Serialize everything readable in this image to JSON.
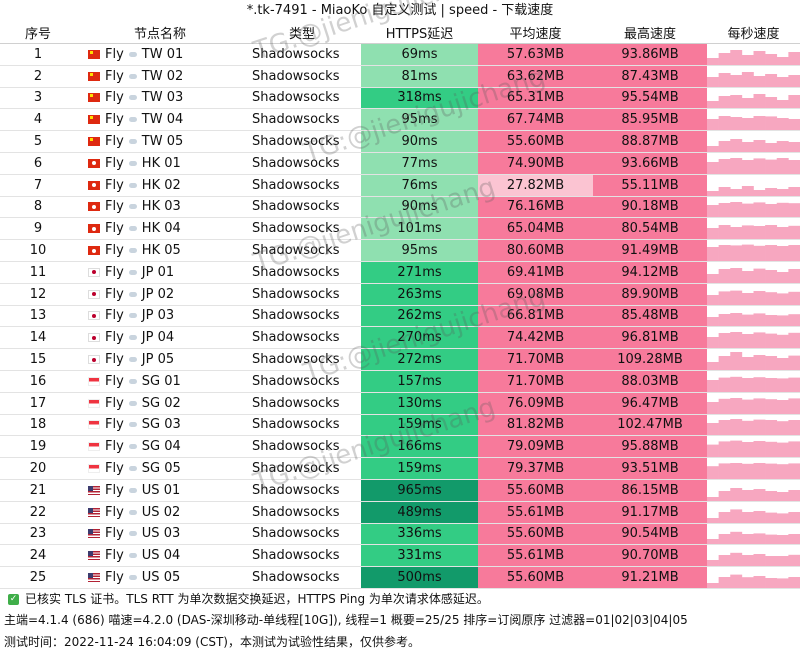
{
  "title": "*.tk-7491 - MiaoKo 自定义测试 | speed - 下载速度",
  "headers": {
    "no": "序号",
    "name": "节点名称",
    "type": "类型",
    "latency": "HTTPS延迟",
    "avg": "平均速度",
    "max": "最高速度",
    "per_second": "每秒速度"
  },
  "flag_icons": {
    "TW": "flag-cn-icon",
    "HK": "flag-hk-icon",
    "JP": "flag-jp-icon",
    "SG": "flag-sg-icon",
    "US": "flag-us-icon"
  },
  "colors": {
    "latency_light": "#8fe0b0",
    "latency_mid": "#33cc84",
    "latency_dark": "#129a6a",
    "speed_pink": "#f77a9b",
    "speed_pale": "#fbc4d2",
    "spark_pink": "#f7a7c0"
  },
  "rows": [
    {
      "no": "1",
      "prefix": "Fly",
      "node": "TW 01",
      "region": "TW",
      "type": "Shadowsocks",
      "latency": "69ms",
      "avg": "57.63MB",
      "max": "93.86MB",
      "spark": [
        0.35,
        0.6,
        0.75,
        0.5,
        0.7,
        0.55,
        0.4,
        0.65
      ]
    },
    {
      "no": "2",
      "prefix": "Fly",
      "node": "TW 02",
      "region": "TW",
      "type": "Shadowsocks",
      "latency": "81ms",
      "avg": "63.62MB",
      "max": "87.43MB",
      "spark": [
        0.5,
        0.7,
        0.6,
        0.75,
        0.55,
        0.65,
        0.5,
        0.6
      ]
    },
    {
      "no": "3",
      "prefix": "Fly",
      "node": "TW 03",
      "region": "TW",
      "type": "Shadowsocks",
      "latency": "318ms",
      "avg": "65.31MB",
      "max": "95.54MB",
      "spark": [
        0.4,
        0.65,
        0.7,
        0.55,
        0.75,
        0.6,
        0.45,
        0.7
      ]
    },
    {
      "no": "4",
      "prefix": "Fly",
      "node": "TW 04",
      "region": "TW",
      "type": "Shadowsocks",
      "latency": "95ms",
      "avg": "67.74MB",
      "max": "85.95MB",
      "spark": [
        0.55,
        0.7,
        0.65,
        0.6,
        0.7,
        0.68,
        0.6,
        0.55
      ]
    },
    {
      "no": "5",
      "prefix": "Fly",
      "node": "TW 05",
      "region": "TW",
      "type": "Shadowsocks",
      "latency": "90ms",
      "avg": "55.60MB",
      "max": "88.87MB",
      "spark": [
        0.3,
        0.55,
        0.65,
        0.5,
        0.6,
        0.45,
        0.55,
        0.5
      ]
    },
    {
      "no": "6",
      "prefix": "Fly",
      "node": "HK 01",
      "region": "HK",
      "type": "Shadowsocks",
      "latency": "77ms",
      "avg": "74.90MB",
      "max": "93.66MB",
      "spark": [
        0.6,
        0.75,
        0.8,
        0.7,
        0.78,
        0.72,
        0.8,
        0.7
      ]
    },
    {
      "no": "7",
      "prefix": "Fly",
      "node": "HK 02",
      "region": "HK",
      "type": "Shadowsocks",
      "latency": "76ms",
      "avg": "27.82MB",
      "max": "55.11MB",
      "spark": [
        0.25,
        0.45,
        0.35,
        0.5,
        0.3,
        0.4,
        0.35,
        0.45
      ]
    },
    {
      "no": "8",
      "prefix": "Fly",
      "node": "HK 03",
      "region": "HK",
      "type": "Shadowsocks",
      "latency": "90ms",
      "avg": "76.16MB",
      "max": "90.18MB",
      "spark": [
        0.65,
        0.75,
        0.8,
        0.72,
        0.78,
        0.7,
        0.76,
        0.74
      ]
    },
    {
      "no": "9",
      "prefix": "Fly",
      "node": "HK 04",
      "region": "HK",
      "type": "Shadowsocks",
      "latency": "101ms",
      "avg": "65.04MB",
      "max": "80.54MB",
      "spark": [
        0.55,
        0.7,
        0.6,
        0.68,
        0.65,
        0.7,
        0.6,
        0.66
      ]
    },
    {
      "no": "10",
      "prefix": "Fly",
      "node": "HK 05",
      "region": "HK",
      "type": "Shadowsocks",
      "latency": "95ms",
      "avg": "80.60MB",
      "max": "91.49MB",
      "spark": [
        0.7,
        0.8,
        0.78,
        0.82,
        0.76,
        0.8,
        0.75,
        0.8
      ]
    },
    {
      "no": "11",
      "prefix": "Fly",
      "node": "JP 01",
      "region": "JP",
      "type": "Shadowsocks",
      "latency": "271ms",
      "avg": "69.41MB",
      "max": "94.12MB",
      "spark": [
        0.45,
        0.7,
        0.75,
        0.6,
        0.72,
        0.65,
        0.55,
        0.7
      ]
    },
    {
      "no": "12",
      "prefix": "Fly",
      "node": "JP 02",
      "region": "JP",
      "type": "Shadowsocks",
      "latency": "263ms",
      "avg": "69.08MB",
      "max": "89.90MB",
      "spark": [
        0.5,
        0.68,
        0.72,
        0.6,
        0.7,
        0.64,
        0.58,
        0.66
      ]
    },
    {
      "no": "13",
      "prefix": "Fly",
      "node": "JP 03",
      "region": "JP",
      "type": "Shadowsocks",
      "latency": "262ms",
      "avg": "66.81MB",
      "max": "85.48MB",
      "spark": [
        0.5,
        0.65,
        0.7,
        0.62,
        0.68,
        0.6,
        0.58,
        0.64
      ]
    },
    {
      "no": "14",
      "prefix": "Fly",
      "node": "JP 04",
      "region": "JP",
      "type": "Shadowsocks",
      "latency": "270ms",
      "avg": "74.42MB",
      "max": "96.81MB",
      "spark": [
        0.55,
        0.75,
        0.8,
        0.7,
        0.78,
        0.72,
        0.66,
        0.76
      ]
    },
    {
      "no": "15",
      "prefix": "Fly",
      "node": "JP 05",
      "region": "JP",
      "type": "Shadowsocks",
      "latency": "272ms",
      "avg": "71.70MB",
      "max": "109.28MB",
      "spark": [
        0.4,
        0.7,
        0.9,
        0.65,
        0.75,
        0.7,
        0.6,
        0.72
      ]
    },
    {
      "no": "16",
      "prefix": "Fly",
      "node": "SG 01",
      "region": "SG",
      "type": "Shadowsocks",
      "latency": "157ms",
      "avg": "71.70MB",
      "max": "88.03MB",
      "spark": [
        0.6,
        0.72,
        0.76,
        0.7,
        0.74,
        0.7,
        0.68,
        0.72
      ]
    },
    {
      "no": "17",
      "prefix": "Fly",
      "node": "SG 02",
      "region": "SG",
      "type": "Shadowsocks",
      "latency": "130ms",
      "avg": "76.09MB",
      "max": "96.47MB",
      "spark": [
        0.6,
        0.76,
        0.8,
        0.72,
        0.78,
        0.74,
        0.7,
        0.78
      ]
    },
    {
      "no": "18",
      "prefix": "Fly",
      "node": "SG 03",
      "region": "SG",
      "type": "Shadowsocks",
      "latency": "159ms",
      "avg": "81.82MB",
      "max": "102.47MB",
      "spark": [
        0.65,
        0.8,
        0.85,
        0.76,
        0.82,
        0.8,
        0.74,
        0.8
      ]
    },
    {
      "no": "19",
      "prefix": "Fly",
      "node": "SG 04",
      "region": "SG",
      "type": "Shadowsocks",
      "latency": "166ms",
      "avg": "79.09MB",
      "max": "95.88MB",
      "spark": [
        0.62,
        0.78,
        0.82,
        0.75,
        0.8,
        0.76,
        0.72,
        0.78
      ]
    },
    {
      "no": "20",
      "prefix": "Fly",
      "node": "SG 05",
      "region": "SG",
      "type": "Shadowsocks",
      "latency": "159ms",
      "avg": "79.37MB",
      "max": "93.51MB",
      "spark": [
        0.64,
        0.78,
        0.8,
        0.76,
        0.8,
        0.77,
        0.74,
        0.78
      ]
    },
    {
      "no": "21",
      "prefix": "Fly",
      "node": "US 01",
      "region": "US",
      "type": "Shadowsocks",
      "latency": "965ms",
      "avg": "55.60MB",
      "max": "86.15MB",
      "spark": [
        0.2,
        0.5,
        0.65,
        0.55,
        0.6,
        0.5,
        0.45,
        0.55
      ]
    },
    {
      "no": "22",
      "prefix": "Fly",
      "node": "US 02",
      "region": "US",
      "type": "Shadowsocks",
      "latency": "489ms",
      "avg": "55.61MB",
      "max": "91.17MB",
      "spark": [
        0.25,
        0.55,
        0.68,
        0.55,
        0.6,
        0.52,
        0.48,
        0.55
      ]
    },
    {
      "no": "23",
      "prefix": "Fly",
      "node": "US 03",
      "region": "US",
      "type": "Shadowsocks",
      "latency": "336ms",
      "avg": "55.60MB",
      "max": "90.54MB",
      "spark": [
        0.3,
        0.55,
        0.66,
        0.55,
        0.58,
        0.52,
        0.5,
        0.55
      ]
    },
    {
      "no": "24",
      "prefix": "Fly",
      "node": "US 04",
      "region": "US",
      "type": "Shadowsocks",
      "latency": "331ms",
      "avg": "55.61MB",
      "max": "90.70MB",
      "spark": [
        0.3,
        0.55,
        0.66,
        0.55,
        0.6,
        0.5,
        0.5,
        0.56
      ]
    },
    {
      "no": "25",
      "prefix": "Fly",
      "node": "US 05",
      "region": "US",
      "type": "Shadowsocks",
      "latency": "500ms",
      "avg": "55.60MB",
      "max": "91.21MB",
      "spark": [
        0.25,
        0.55,
        0.67,
        0.54,
        0.6,
        0.5,
        0.48,
        0.55
      ]
    }
  ],
  "footer": {
    "tls_note": "已核实 TLS 证书。TLS RTT 为单次数据交换延迟，HTTPS Ping 为单次请求体感延迟。",
    "backend_info": "主端=4.1.4 (686) 喵速=4.2.0 (DAS-深圳移动-单线程[10G]), 线程=1 概要=25/25 排序=订阅原序 过滤器=01|02|03|04|05",
    "test_time": "测试时间：2022-11-24 16:04:09 (CST)，本测试为试验性结果，仅供参考。"
  },
  "watermark": "TG:@jienigujichang"
}
